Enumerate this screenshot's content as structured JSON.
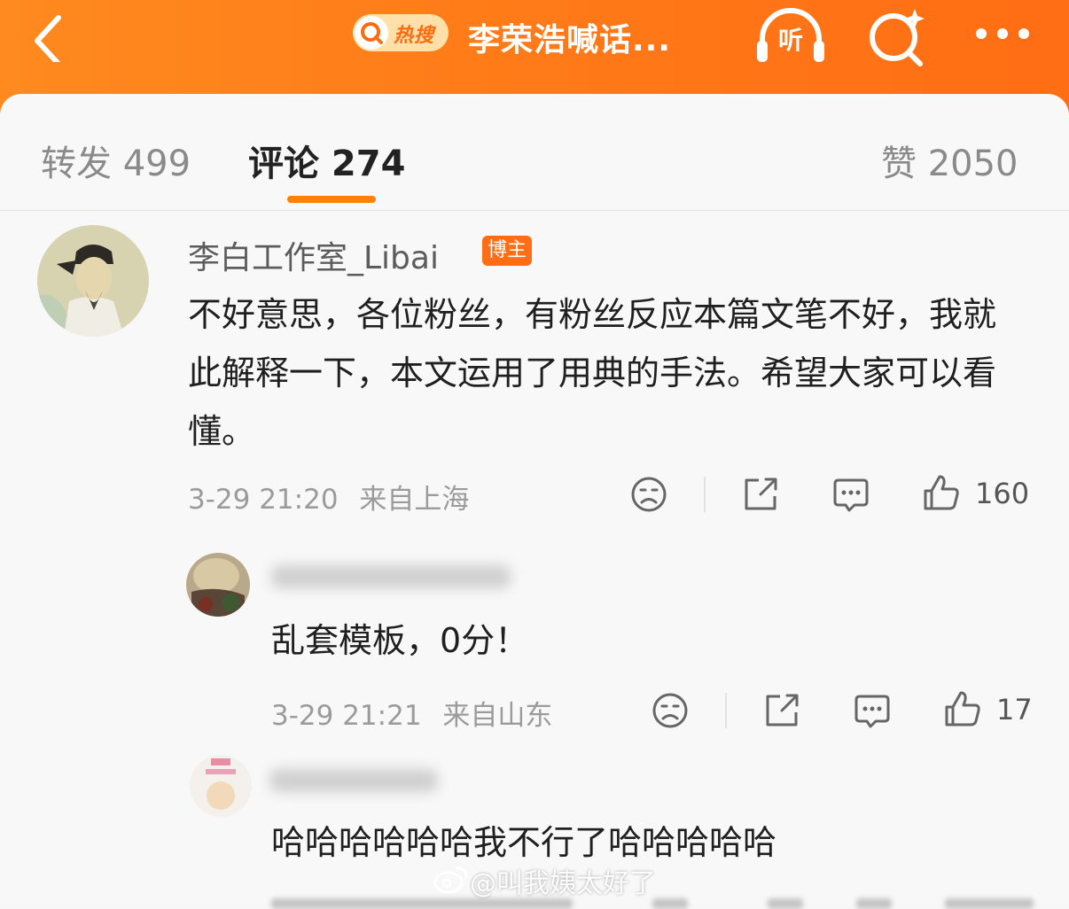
{
  "header": {
    "hot_search_label": "热搜",
    "title": "李荣浩喊话...",
    "listen_label": "听"
  },
  "tabs": {
    "repost": "转发 499",
    "comment": "评论 274",
    "like": "赞 2050"
  },
  "comments": [
    {
      "username": "李白工作室_Libai",
      "badge": "博主",
      "text": "不好意思，各位粉丝，有粉丝反应本篇文笔不好，我就此解释一下，本文运用了用典的手法。希望大家可以看懂。",
      "time": "3-29 21:20",
      "location": "来自上海",
      "likes": "160"
    },
    {
      "username": "",
      "text": "乱套模板，0分！",
      "time": "3-29 21:21",
      "location": "来自山东",
      "likes": "17"
    },
    {
      "username": "",
      "text": "哈哈哈哈哈哈我不行了哈哈哈哈哈"
    }
  ],
  "watermark": "@叫我姨太好了",
  "colors": {
    "header_orange": "#ff7a18",
    "tab_underline": "#ff8200",
    "badge": "#ff6d14"
  }
}
